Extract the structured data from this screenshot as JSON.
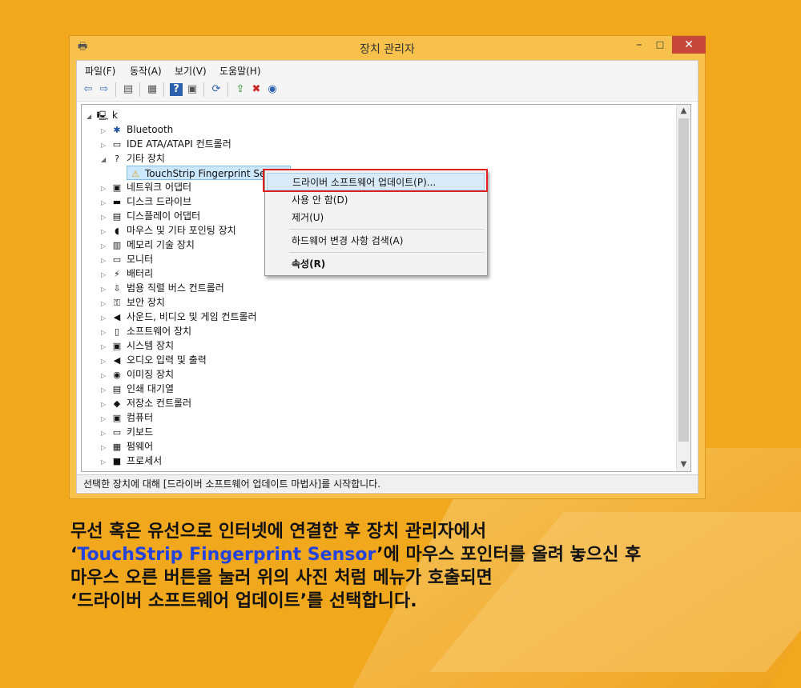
{
  "window": {
    "title": "장치 관리자",
    "controls": {
      "minimize": "–",
      "maximize": "□",
      "close": "✕"
    }
  },
  "menubar": [
    "파일(F)",
    "동작(A)",
    "보기(V)",
    "도움말(H)"
  ],
  "tree": {
    "root": "k",
    "items": [
      {
        "label": "Bluetooth",
        "icon": "bluetooth-icon",
        "glyph": "✱",
        "expanded": false
      },
      {
        "label": "IDE ATA/ATAPI 컨트롤러",
        "icon": "ide-controller-icon",
        "glyph": "▭",
        "expanded": false
      },
      {
        "label": "기타 장치",
        "icon": "other-devices-icon",
        "glyph": "?",
        "expanded": true
      },
      {
        "label": "TouchStrip Fingerprint Sensor",
        "icon": "warning-device-icon",
        "glyph": "⚠",
        "child": true,
        "selected": true
      },
      {
        "label": "네트워크 어댑터",
        "icon": "network-adapter-icon",
        "glyph": "▣",
        "expanded": false
      },
      {
        "label": "디스크 드라이브",
        "icon": "disk-drive-icon",
        "glyph": "▬",
        "expanded": false
      },
      {
        "label": "디스플레이 어댑터",
        "icon": "display-adapter-icon",
        "glyph": "▤",
        "expanded": false
      },
      {
        "label": "마우스 및 기타 포인팅 장치",
        "icon": "mouse-icon",
        "glyph": "◖",
        "expanded": false
      },
      {
        "label": "메모리 기술 장치",
        "icon": "memory-icon",
        "glyph": "▥",
        "expanded": false
      },
      {
        "label": "모니터",
        "icon": "monitor-icon",
        "glyph": "▭",
        "expanded": false
      },
      {
        "label": "배터리",
        "icon": "battery-icon",
        "glyph": "⚡",
        "expanded": false
      },
      {
        "label": "범용 직렬 버스 컨트롤러",
        "icon": "usb-icon",
        "glyph": "⇩",
        "expanded": false
      },
      {
        "label": "보안 장치",
        "icon": "security-key-icon",
        "glyph": "⚿",
        "expanded": false
      },
      {
        "label": "사운드, 비디오 및 게임 컨트롤러",
        "icon": "speaker-icon",
        "glyph": "◀",
        "expanded": false
      },
      {
        "label": "소프트웨어 장치",
        "icon": "software-device-icon",
        "glyph": "▯",
        "expanded": false
      },
      {
        "label": "시스템 장치",
        "icon": "system-device-icon",
        "glyph": "▣",
        "expanded": false
      },
      {
        "label": "오디오 입력 및 출력",
        "icon": "audio-icon",
        "glyph": "◀",
        "expanded": false
      },
      {
        "label": "이미징 장치",
        "icon": "camera-icon",
        "glyph": "◉",
        "expanded": false
      },
      {
        "label": "인쇄 대기열",
        "icon": "printer-icon",
        "glyph": "▤",
        "expanded": false
      },
      {
        "label": "저장소 컨트롤러",
        "icon": "storage-controller-icon",
        "glyph": "◆",
        "expanded": false
      },
      {
        "label": "컴퓨터",
        "icon": "computer-icon",
        "glyph": "▣",
        "expanded": false
      },
      {
        "label": "키보드",
        "icon": "keyboard-icon",
        "glyph": "▭",
        "expanded": false
      },
      {
        "label": "펌웨어",
        "icon": "firmware-icon",
        "glyph": "▦",
        "expanded": false
      },
      {
        "label": "프로세서",
        "icon": "processor-icon",
        "glyph": "■",
        "expanded": false
      }
    ]
  },
  "context_menu": {
    "update_driver": "드라이버 소프트웨어 업데이트(P)...",
    "disable": "사용 안 함(D)",
    "uninstall": "제거(U)",
    "scan": "하드웨어 변경 사항 검색(A)",
    "properties": "속성(R)"
  },
  "statusbar": "선택한 장치에 대해 [드라이버 소프트웨어 업데이트 마법사]를 시작합니다.",
  "caption": {
    "line1": "무선 혹은 유선으로 인터넷에 연결한 후 장치 관리자에서",
    "line2_quote_open": "‘",
    "line2_highlight": "TouchStrip Fingerprint Sensor",
    "line2_rest": "’에 마우스 포인터를 올려 놓으신 후",
    "line3": "마우스 오른 버튼을 눌러 위의 사진 처럼 메뉴가 호출되면",
    "line4": "‘드라이버 소프트웨어 업데이트’를 선택합니다."
  },
  "colors": {
    "background": "#f2a81d",
    "window_frame": "#f7c14b",
    "highlight_text": "#2244dd",
    "red_box": "#e02020"
  }
}
